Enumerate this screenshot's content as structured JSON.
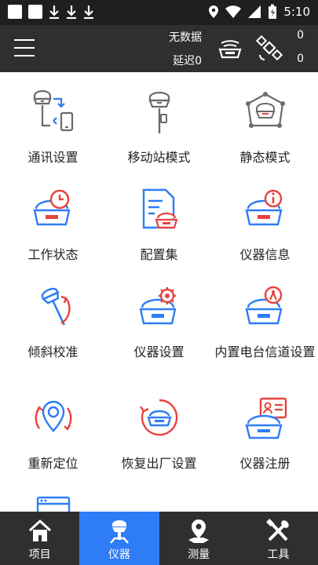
{
  "status_bar": {
    "time": "5:10"
  },
  "app_bar": {
    "data_status": "无数据",
    "latency": "延迟0",
    "count_top": "0",
    "count_bottom": "0"
  },
  "grid": [
    {
      "label": "通讯设置",
      "icon": "communication-settings-icon"
    },
    {
      "label": "移动站模式",
      "icon": "rover-mode-icon"
    },
    {
      "label": "静态模式",
      "icon": "static-mode-icon"
    },
    {
      "label": "工作状态",
      "icon": "work-status-icon"
    },
    {
      "label": "配置集",
      "icon": "config-set-icon"
    },
    {
      "label": "仪器信息",
      "icon": "instrument-info-icon"
    },
    {
      "label": "倾斜校准",
      "icon": "tilt-calibration-icon"
    },
    {
      "label": "仪器设置",
      "icon": "instrument-settings-icon"
    },
    {
      "label": "内置电台信道设置",
      "icon": "radio-channel-icon"
    },
    {
      "label": "重新定位",
      "icon": "relocate-icon"
    },
    {
      "label": "恢复出厂设置",
      "icon": "factory-reset-icon"
    },
    {
      "label": "仪器注册",
      "icon": "instrument-register-icon"
    }
  ],
  "bottom_nav": [
    {
      "label": "项目",
      "icon": "home-icon",
      "active": false
    },
    {
      "label": "仪器",
      "icon": "instrument-icon",
      "active": true
    },
    {
      "label": "测量",
      "icon": "survey-pin-icon",
      "active": false
    },
    {
      "label": "工具",
      "icon": "tools-icon",
      "active": false
    }
  ],
  "colors": {
    "accent_blue": "#2e7cf6",
    "accent_red": "#e8423d",
    "icon_gray": "#6b6b6b",
    "bar_dark": "#2f2f2f"
  }
}
